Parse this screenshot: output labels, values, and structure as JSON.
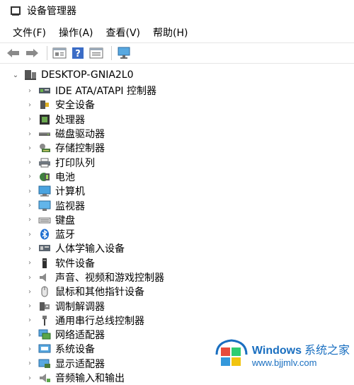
{
  "window": {
    "title": "设备管理器"
  },
  "menu": [
    "文件(F)",
    "操作(A)",
    "查看(V)",
    "帮助(H)"
  ],
  "toolbar": [
    "back-icon",
    "forward-icon",
    "properties-icon",
    "help-icon",
    "view-icon",
    "scan-icon"
  ],
  "tree": {
    "root": "DESKTOP-GNIA2L0",
    "children": [
      {
        "label": "IDE ATA/ATAPI 控制器",
        "icon": "ide-controller-icon"
      },
      {
        "label": "安全设备",
        "icon": "security-device-icon"
      },
      {
        "label": "处理器",
        "icon": "processor-icon"
      },
      {
        "label": "磁盘驱动器",
        "icon": "disk-drive-icon"
      },
      {
        "label": "存储控制器",
        "icon": "storage-controller-icon"
      },
      {
        "label": "打印队列",
        "icon": "printer-icon"
      },
      {
        "label": "电池",
        "icon": "battery-icon"
      },
      {
        "label": "计算机",
        "icon": "computer-icon"
      },
      {
        "label": "监视器",
        "icon": "monitor-icon"
      },
      {
        "label": "键盘",
        "icon": "keyboard-icon"
      },
      {
        "label": "蓝牙",
        "icon": "bluetooth-icon"
      },
      {
        "label": "人体学输入设备",
        "icon": "hid-icon"
      },
      {
        "label": "软件设备",
        "icon": "software-device-icon"
      },
      {
        "label": "声音、视频和游戏控制器",
        "icon": "sound-icon"
      },
      {
        "label": "鼠标和其他指针设备",
        "icon": "mouse-icon"
      },
      {
        "label": "调制解调器",
        "icon": "modem-icon"
      },
      {
        "label": "通用串行总线控制器",
        "icon": "usb-icon"
      },
      {
        "label": "网络适配器",
        "icon": "network-adapter-icon"
      },
      {
        "label": "系统设备",
        "icon": "system-device-icon"
      },
      {
        "label": "显示适配器",
        "icon": "display-adapter-icon"
      },
      {
        "label": "音频输入和输出",
        "icon": "audio-io-icon"
      }
    ]
  },
  "watermark": {
    "brand": "Windows",
    "cn": "系统之家",
    "url": "www.bjjmlv.com"
  }
}
